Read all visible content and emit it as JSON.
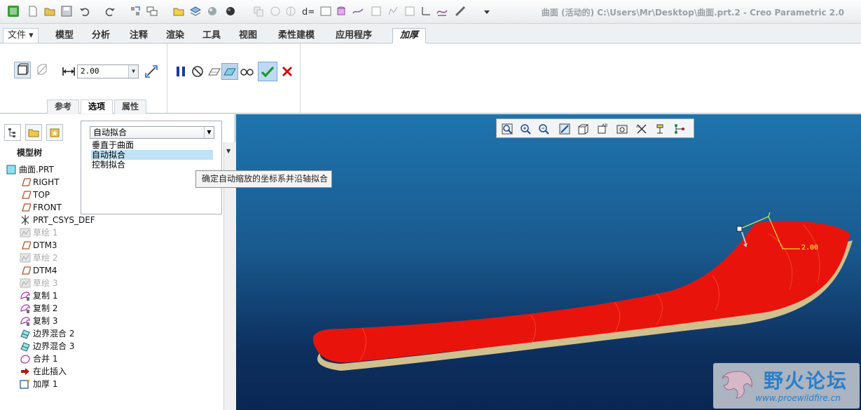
{
  "window": {
    "title": "曲面 (活动的) C:\\Users\\Mr\\Desktop\\曲面.prt.2 - Creo Parametric 2.0"
  },
  "quick_access": {
    "icons": [
      "app-icon",
      "new-icon",
      "open-icon",
      "save-icon",
      "undo-icon",
      "redo-icon",
      "regenerate-icon",
      "windows-icon",
      "folder-icon",
      "layers-icon",
      "appearance-icon",
      "copy-icon",
      "paste-icon",
      "relations-icon",
      "parameters-icon",
      "family-table-icon",
      "datum-icon",
      "analysis-icon",
      "measure-icon",
      "customize-icon"
    ]
  },
  "ribbon": {
    "tabs": [
      {
        "label": "文件 ▾"
      },
      {
        "label": "模型"
      },
      {
        "label": "分析"
      },
      {
        "label": "注释"
      },
      {
        "label": "渲染"
      },
      {
        "label": "工具"
      },
      {
        "label": "视图"
      },
      {
        "label": "柔性建模"
      },
      {
        "label": "应用程序"
      },
      {
        "label": "加厚"
      }
    ],
    "active_tab": "加厚",
    "thickness_value": "2.00",
    "subtabs": [
      {
        "label": "参考"
      },
      {
        "label": "选项"
      },
      {
        "label": "属性"
      }
    ],
    "active_subtab": "选项"
  },
  "left_panel": {
    "header": "模型树",
    "tree": [
      {
        "label": "曲面.PRT",
        "icon": "part-icon",
        "dim": false
      },
      {
        "label": "RIGHT",
        "icon": "datum-plane-icon",
        "dim": false
      },
      {
        "label": "TOP",
        "icon": "datum-plane-icon",
        "dim": false
      },
      {
        "label": "FRONT",
        "icon": "datum-plane-icon",
        "dim": false
      },
      {
        "label": "PRT_CSYS_DEF",
        "icon": "csys-icon",
        "dim": false
      },
      {
        "label": "草绘 1",
        "icon": "sketch-icon",
        "dim": true
      },
      {
        "label": "DTM3",
        "icon": "datum-plane-icon",
        "dim": false
      },
      {
        "label": "草绘 2",
        "icon": "sketch-icon",
        "dim": true
      },
      {
        "label": "DTM4",
        "icon": "datum-plane-icon",
        "dim": false
      },
      {
        "label": "草绘 3",
        "icon": "sketch-icon",
        "dim": true
      },
      {
        "label": "复制 1",
        "icon": "copy-surface-icon",
        "dim": false
      },
      {
        "label": "复制 2",
        "icon": "copy-surface-icon",
        "dim": false
      },
      {
        "label": "复制 3",
        "icon": "copy-surface-icon",
        "dim": false
      },
      {
        "label": "边界混合 2",
        "icon": "boundary-blend-icon",
        "dim": false
      },
      {
        "label": "边界混合 3",
        "icon": "boundary-blend-icon",
        "dim": false
      },
      {
        "label": "合并 1",
        "icon": "merge-icon",
        "dim": false
      },
      {
        "label": "在此插入",
        "icon": "insert-here-icon",
        "dim": false
      },
      {
        "label": "加厚 1",
        "icon": "thicken-icon",
        "dim": false
      }
    ]
  },
  "options_popup": {
    "selected": "自动拟合",
    "options": [
      {
        "label": "垂直于曲面",
        "selected": false
      },
      {
        "label": "自动拟合",
        "selected": true
      },
      {
        "label": "控制拟合",
        "selected": false
      }
    ],
    "tooltip": "确定自动缩放的坐标系并沿轴拟合"
  },
  "viewport": {
    "dimension_label": "2.00",
    "toolbar_icons": [
      "refit-icon",
      "zoom-in-icon",
      "zoom-out-icon",
      "repaint-icon",
      "display-style-icon",
      "saved-views-icon",
      "view-manager-icon",
      "datum-display-icon",
      "annotation-display-icon",
      "spin-center-icon"
    ],
    "model_color": "#e8140c",
    "watermark": {
      "title": "野火论坛",
      "url": "www.proewildfire.cn"
    }
  }
}
